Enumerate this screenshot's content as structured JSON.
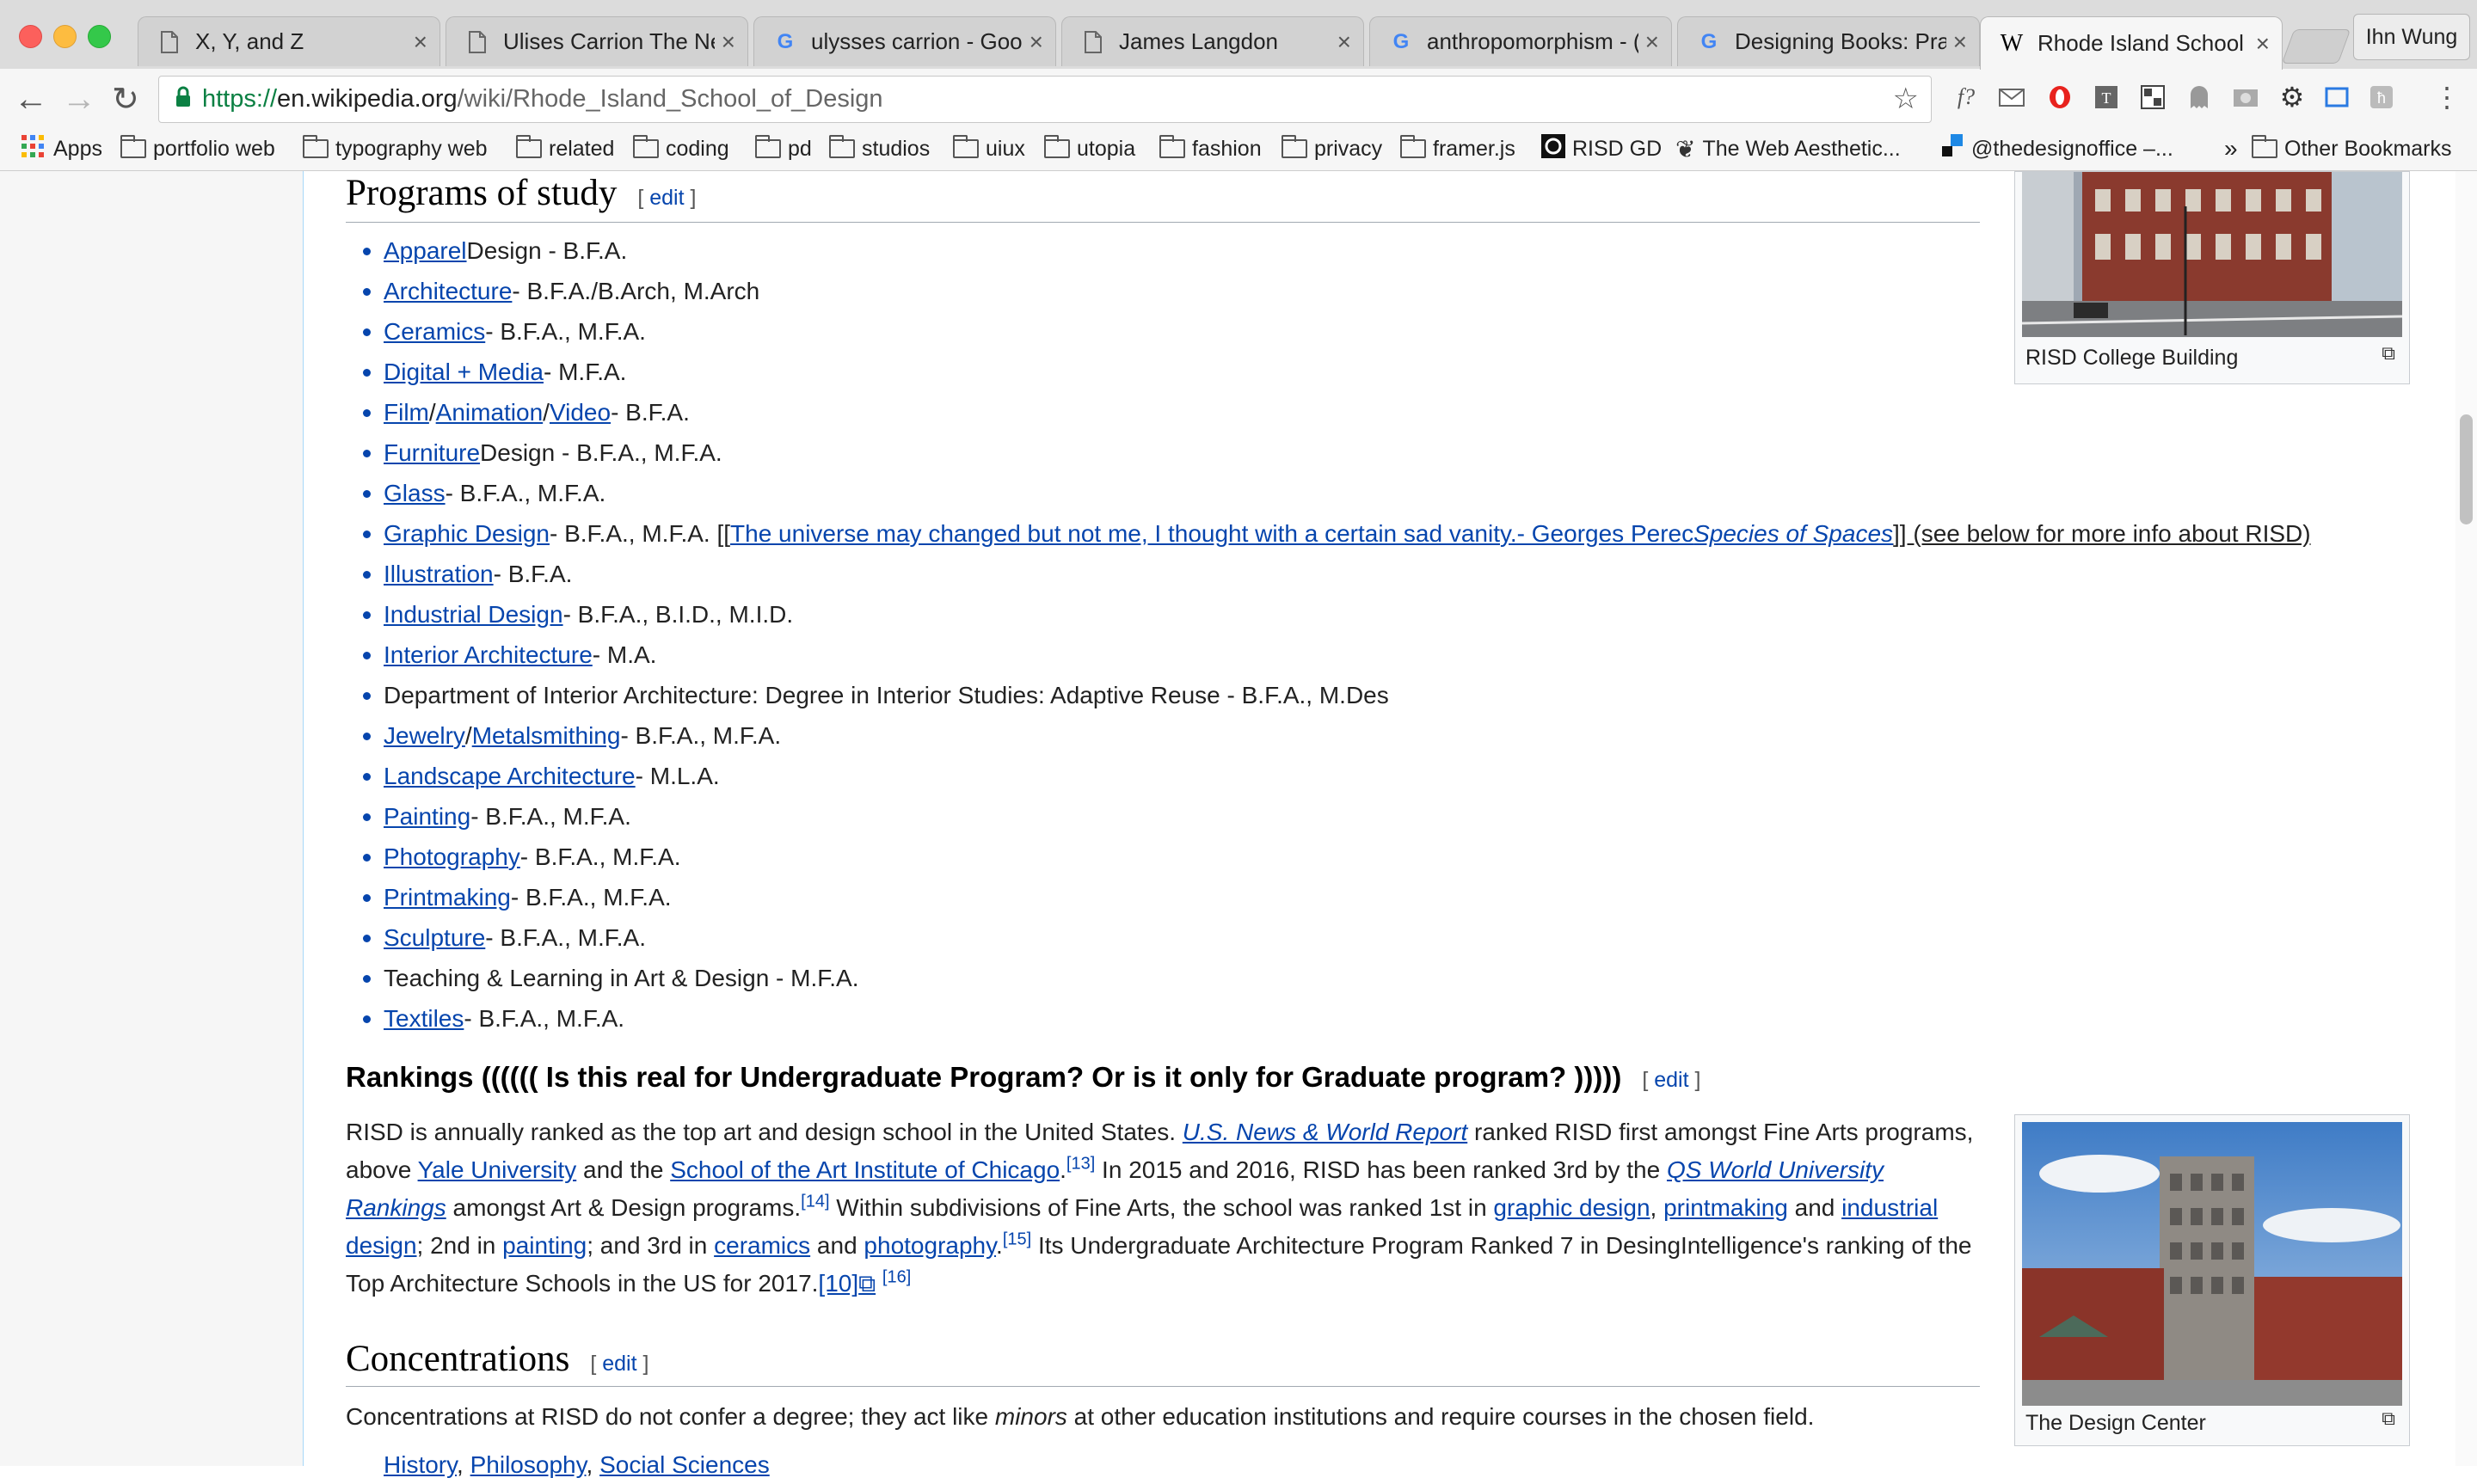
{
  "browser": {
    "tabs": [
      {
        "title": "X, Y, and Z",
        "icon": "page-icon"
      },
      {
        "title": "Ulises Carrion The Ne",
        "icon": "page-icon"
      },
      {
        "title": "ulysses carrion - Goo",
        "icon": "google-icon"
      },
      {
        "title": "James Langdon",
        "icon": "page-icon"
      },
      {
        "title": "anthropomorphism - (",
        "icon": "google-icon"
      },
      {
        "title": "Designing Books: Pra",
        "icon": "google-icon"
      },
      {
        "title": "Rhode Island School o",
        "icon": "wikipedia-icon",
        "active": true
      }
    ],
    "profile": "Ihn Wung",
    "url": {
      "protocol": "https://",
      "host": "en.wikipedia.org",
      "path": "/wiki/Rhode_Island_School_of_Design"
    },
    "bookmarks": [
      {
        "label": "Apps",
        "icon": "apps-grid-icon"
      },
      {
        "label": "portfolio web",
        "icon": "folder-icon"
      },
      {
        "label": "typography web",
        "icon": "folder-icon"
      },
      {
        "label": "related",
        "icon": "folder-icon"
      },
      {
        "label": "coding",
        "icon": "folder-icon"
      },
      {
        "label": "pd",
        "icon": "folder-icon"
      },
      {
        "label": "studios",
        "icon": "folder-icon"
      },
      {
        "label": "uiux",
        "icon": "folder-icon"
      },
      {
        "label": "utopia",
        "icon": "folder-icon"
      },
      {
        "label": "fashion",
        "icon": "folder-icon"
      },
      {
        "label": "privacy",
        "icon": "folder-icon"
      },
      {
        "label": "framer.js",
        "icon": "folder-icon"
      },
      {
        "label": "RISD GD",
        "icon": "risd-icon"
      },
      {
        "label": "The Web Aesthetic...",
        "icon": "laurel-icon"
      },
      {
        "label": "@thedesignoffice –...",
        "icon": "designoffice-icon"
      }
    ],
    "overflow": "»",
    "other_bookmarks": "Other Bookmarks",
    "extension_f": "f?"
  },
  "article": {
    "programs": {
      "heading": "Programs of study",
      "edit": "edit",
      "items": [
        {
          "parts": [
            {
              "t": "Apparel",
              "link": true
            },
            {
              "t": " Design - B.F.A."
            }
          ]
        },
        {
          "parts": [
            {
              "t": "Architecture",
              "link": true
            },
            {
              "t": " - B.F.A./B.Arch, M.Arch"
            }
          ]
        },
        {
          "parts": [
            {
              "t": "Ceramics",
              "link": true
            },
            {
              "t": " - B.F.A., M.F.A."
            }
          ]
        },
        {
          "parts": [
            {
              "t": "Digital + Media",
              "link": true
            },
            {
              "t": " - M.F.A."
            }
          ]
        },
        {
          "parts": [
            {
              "t": "Film",
              "link": true
            },
            {
              "t": "/"
            },
            {
              "t": "Animation",
              "link": true
            },
            {
              "t": "/"
            },
            {
              "t": "Video",
              "link": true
            },
            {
              "t": " - B.F.A."
            }
          ]
        },
        {
          "parts": [
            {
              "t": "Furniture",
              "link": true
            },
            {
              "t": " Design - B.F.A., M.F.A."
            }
          ]
        },
        {
          "parts": [
            {
              "t": "Glass",
              "link": true
            },
            {
              "t": " - B.F.A., M.F.A."
            }
          ]
        },
        {
          "parts": [
            {
              "t": "Graphic Design",
              "link": true
            },
            {
              "t": " - B.F.A., M.F.A. [["
            },
            {
              "t": "The universe may changed but not me, I thought with a certain sad vanity.- Georges Perec ",
              "link": true,
              "underline": true
            },
            {
              "t": "Species of Spaces",
              "link": true,
              "underline": true,
              "italic": true
            },
            {
              "t": "]] (see below for more info about RISD)",
              "underline": true
            }
          ]
        },
        {
          "parts": [
            {
              "t": "Illustration",
              "link": true
            },
            {
              "t": " - B.F.A."
            }
          ]
        },
        {
          "parts": [
            {
              "t": "Industrial Design",
              "link": true
            },
            {
              "t": " - B.F.A., B.I.D., M.I.D."
            }
          ]
        },
        {
          "parts": [
            {
              "t": "Interior Architecture",
              "link": true
            },
            {
              "t": " - M.A."
            }
          ]
        },
        {
          "parts": [
            {
              "t": "Department of Interior Architecture: Degree in Interior Studies: Adaptive Reuse - B.F.A., M.Des"
            }
          ]
        },
        {
          "parts": [
            {
              "t": "Jewelry",
              "link": true
            },
            {
              "t": "/"
            },
            {
              "t": "Metalsmithing",
              "link": true
            },
            {
              "t": " - B.F.A., M.F.A."
            }
          ]
        },
        {
          "parts": [
            {
              "t": "Landscape Architecture",
              "link": true
            },
            {
              "t": " - M.L.A."
            }
          ]
        },
        {
          "parts": [
            {
              "t": "Painting",
              "link": true
            },
            {
              "t": " - B.F.A., M.F.A."
            }
          ]
        },
        {
          "parts": [
            {
              "t": "Photography",
              "link": true
            },
            {
              "t": " - B.F.A., M.F.A."
            }
          ]
        },
        {
          "parts": [
            {
              "t": "Printmaking",
              "link": true
            },
            {
              "t": " - B.F.A., M.F.A."
            }
          ]
        },
        {
          "parts": [
            {
              "t": "Sculpture",
              "link": true
            },
            {
              "t": " - B.F.A., M.F.A."
            }
          ]
        },
        {
          "parts": [
            {
              "t": "Teaching & Learning in Art & Design - M.F.A."
            }
          ]
        },
        {
          "parts": [
            {
              "t": "Textiles",
              "link": true
            },
            {
              "t": " - B.F.A., M.F.A."
            }
          ]
        }
      ]
    },
    "rankings": {
      "heading": "Rankings (((((( Is this real for Undergraduate Program? Or is it only for Graduate program? )))))",
      "edit": "edit",
      "body": [
        {
          "t": "RISD is annually ranked as the top art and design school in the United States. "
        },
        {
          "t": "U.S. News & World Report",
          "link": true,
          "italic": true
        },
        {
          "t": " ranked RISD first amongst Fine Arts programs, above "
        },
        {
          "t": "Yale University",
          "link": true
        },
        {
          "t": " and the "
        },
        {
          "t": "School of the Art Institute of Chicago",
          "link": true
        },
        {
          "t": "."
        },
        {
          "t": "[13]",
          "link": true,
          "sup": true
        },
        {
          "t": " In 2015 and 2016, RISD has been ranked 3rd by the "
        },
        {
          "t": "QS World University Rankings",
          "link": true,
          "italic": true
        },
        {
          "t": " amongst Art & Design programs."
        },
        {
          "t": "[14]",
          "link": true,
          "sup": true
        },
        {
          "t": " Within subdivisions of Fine Arts, the school was ranked 1st in "
        },
        {
          "t": "graphic design",
          "link": true
        },
        {
          "t": ", "
        },
        {
          "t": "printmaking",
          "link": true
        },
        {
          "t": " and "
        },
        {
          "t": "industrial design",
          "link": true
        },
        {
          "t": "; 2nd in "
        },
        {
          "t": "painting",
          "link": true
        },
        {
          "t": "; and 3rd in "
        },
        {
          "t": "ceramics",
          "link": true
        },
        {
          "t": " and "
        },
        {
          "t": "photography",
          "link": true
        },
        {
          "t": "."
        },
        {
          "t": "[15]",
          "link": true,
          "sup": true
        },
        {
          "t": " Its Undergraduate Architecture Program Ranked 7 in DesingIntelligence's ranking of the Top Architecture Schools in the US for 2017."
        },
        {
          "t": "[10]",
          "link": true
        },
        {
          "t": "⧉",
          "link": true
        },
        {
          "t": " "
        },
        {
          "t": "[16]",
          "link": true,
          "sup": true
        }
      ]
    },
    "concentrations": {
      "heading": "Concentrations",
      "edit": "edit",
      "body": [
        {
          "t": "Concentrations at RISD do not confer a degree; they act like "
        },
        {
          "t": "minors",
          "italic": true
        },
        {
          "t": " at other education institutions and require courses in the chosen field."
        }
      ],
      "partial_list": [
        {
          "t": "History",
          "link": true
        },
        {
          "t": ", "
        },
        {
          "t": "Philosophy",
          "link": true
        },
        {
          "t": ", "
        },
        {
          "t": "Social Sciences",
          "link": true
        }
      ]
    },
    "thumbs": [
      {
        "caption": "RISD College Building"
      },
      {
        "caption": "The Design Center"
      }
    ]
  },
  "colors": {
    "link": "#0645ad",
    "text": "#222222",
    "secure_green": "#0b8043"
  }
}
